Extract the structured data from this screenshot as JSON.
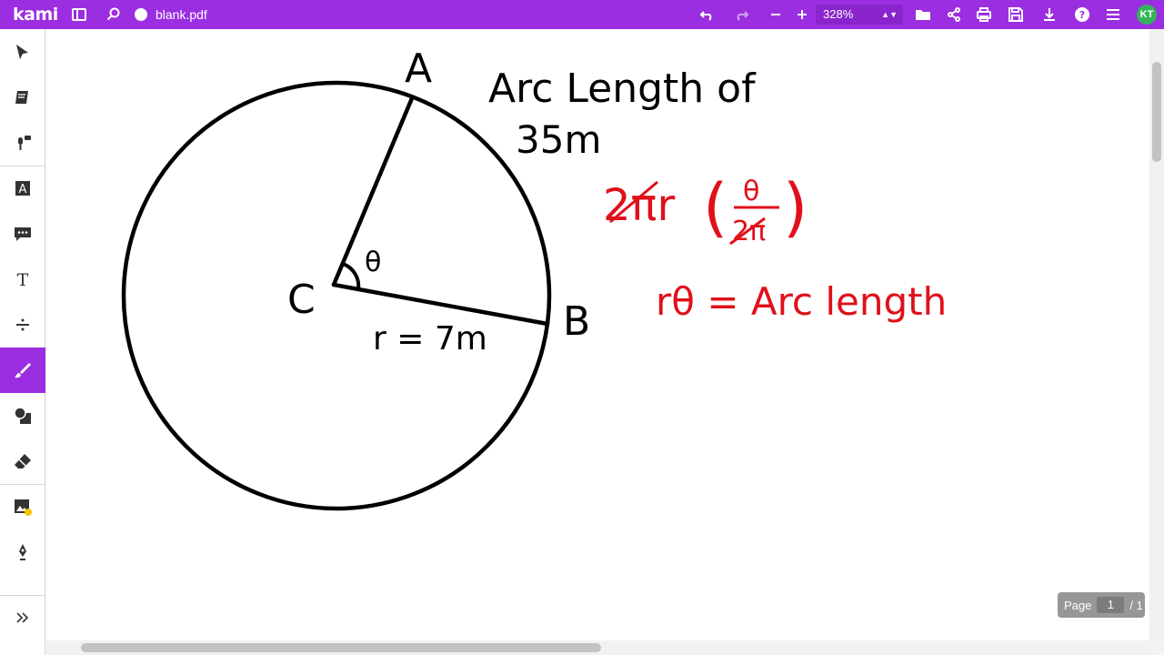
{
  "app": {
    "logo": "kami",
    "file_name": "blank.pdf"
  },
  "toolbar": {
    "zoom": "328%",
    "avatar_initials": "KT",
    "accent": "#9b2ee0",
    "avatar_color": "#35b35a"
  },
  "sidebar": {
    "tools": [
      {
        "name": "select",
        "icon": "cursor-icon"
      },
      {
        "name": "dictionary",
        "icon": "book-icon"
      },
      {
        "name": "speak",
        "icon": "mic-icon"
      },
      {
        "name": "markup",
        "icon": "highlight-icon"
      },
      {
        "name": "comment",
        "icon": "comment-icon"
      },
      {
        "name": "text",
        "icon": "text-icon"
      },
      {
        "name": "equation",
        "icon": "divide-icon"
      },
      {
        "name": "drawing",
        "icon": "brush-icon",
        "active": true
      },
      {
        "name": "shapes",
        "icon": "shapes-icon"
      },
      {
        "name": "eraser",
        "icon": "eraser-icon"
      },
      {
        "name": "add-media",
        "icon": "media-icon"
      },
      {
        "name": "signature",
        "icon": "pen-icon"
      }
    ],
    "expand_icon": "chevrons-right-icon"
  },
  "page_indicator": {
    "label": "Page",
    "current": "1",
    "total": "/ 1"
  },
  "drawing": {
    "point_a": "A",
    "point_b": "B",
    "point_c": "C",
    "angle": "θ",
    "radius_label": "r = 7m",
    "note_line1": "Arc Length of",
    "note_line2": "35m",
    "formula1_left": "2πr",
    "formula1_num": "θ",
    "formula1_den": "2π",
    "formula2": "rθ = Arc length"
  }
}
